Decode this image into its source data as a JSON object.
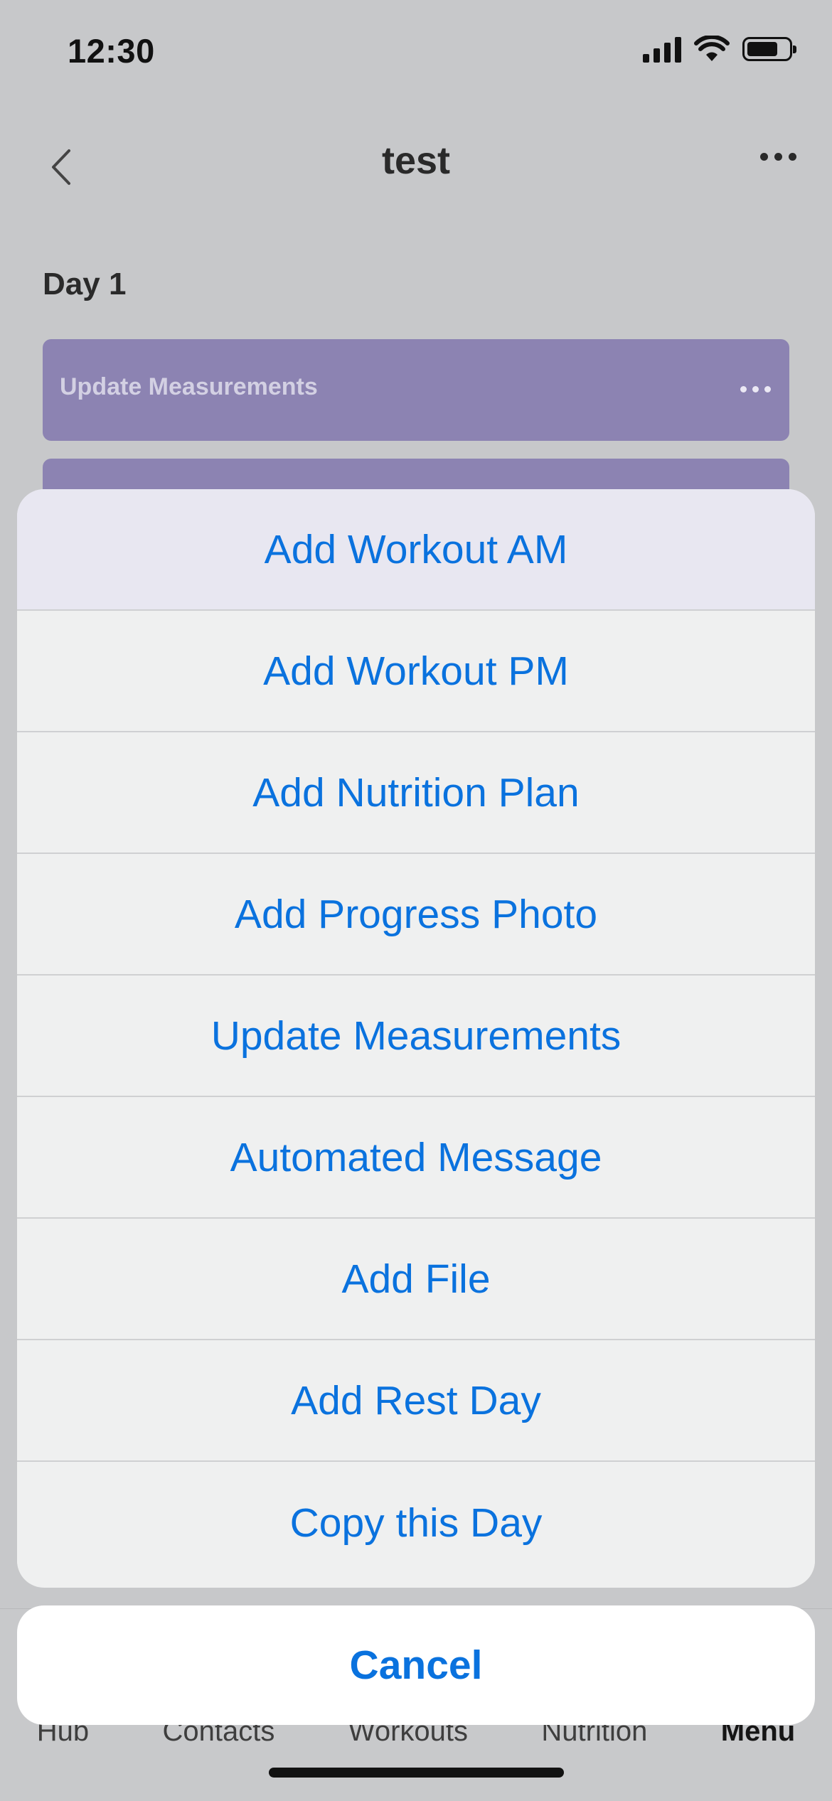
{
  "status_bar": {
    "time": "12:30"
  },
  "nav": {
    "title": "test"
  },
  "day": {
    "label": "Day 1",
    "cards": [
      {
        "label": "Update Measurements"
      }
    ]
  },
  "tab_bar": {
    "items": [
      {
        "label": "Hub"
      },
      {
        "label": "Contacts"
      },
      {
        "label": "Workouts"
      },
      {
        "label": "Nutrition"
      },
      {
        "label": "Menu"
      }
    ]
  },
  "action_sheet": {
    "items": [
      {
        "label": "Add Workout AM"
      },
      {
        "label": "Add Workout PM"
      },
      {
        "label": "Add Nutrition Plan"
      },
      {
        "label": "Add Progress Photo"
      },
      {
        "label": "Update Measurements"
      },
      {
        "label": "Automated Message"
      },
      {
        "label": "Add File"
      },
      {
        "label": "Add Rest Day"
      },
      {
        "label": "Copy this Day"
      }
    ],
    "cancel_label": "Cancel"
  },
  "colors": {
    "accent": "#0a72de",
    "card": "#8c83b2"
  }
}
